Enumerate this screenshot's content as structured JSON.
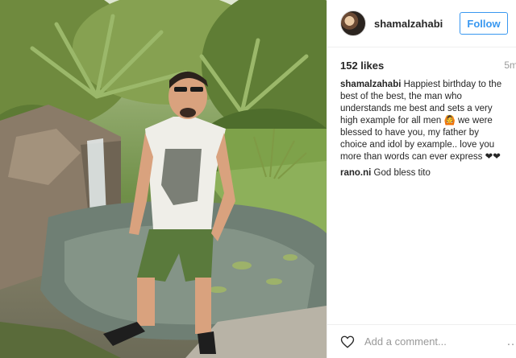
{
  "post": {
    "image_alt": "Man in white t-shirt and green shorts standing by a garden pond with waterfall and palm trees"
  },
  "header": {
    "username": "shamalzahabi",
    "follow_label": "Follow"
  },
  "stats": {
    "likes": "152 likes",
    "time": "5m"
  },
  "comments": [
    {
      "author": "shamalzahabi",
      "text": "Happiest birthday to the best of the best, the man who understands me best and sets a very high example for all men 🙆 we were blessed to have you, my father by choice and idol by example.. love you more than words can ever express ❤❤"
    },
    {
      "author": "rano.ni",
      "text": "God bless tito"
    }
  ],
  "footer": {
    "comment_placeholder": "Add a comment...",
    "more_label": "…"
  },
  "colors": {
    "accent": "#3897f0",
    "text": "#262626",
    "muted": "#999999"
  }
}
